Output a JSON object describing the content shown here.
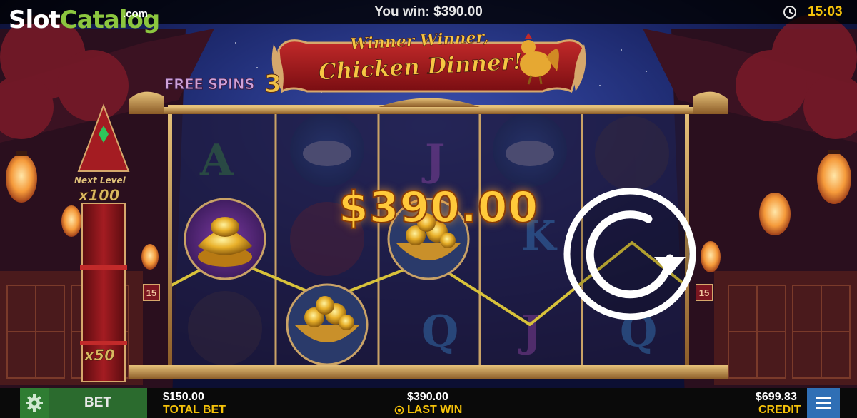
{
  "app": {
    "title": "Winner Winner, Chicken Dinner!"
  },
  "brand": {
    "logo_part1": "Slot",
    "logo_part2": "Catalog",
    "logo_suffix": ".com"
  },
  "header": {
    "win_message": "You win: $390.00",
    "time": "15:03"
  },
  "banner": {
    "line1": "Winner Winner,",
    "line2": "Chicken Dinner!"
  },
  "free_spins": {
    "label": "FREE SPINS",
    "count": "3"
  },
  "meter": {
    "next_level_label": "Next Level",
    "next_multiplier": "x100",
    "current_multiplier": "x50"
  },
  "win": {
    "amount": "$390.00"
  },
  "paylines": {
    "left_number": "15",
    "right_number": "15"
  },
  "footer": {
    "bet_label": "BET",
    "total_bet_value": "$150.00",
    "total_bet_label": "TOTAL BET",
    "last_win_value": "$390.00",
    "last_win_label": "LAST WIN",
    "credit_value": "$699.83",
    "credit_label": "CREDIT"
  },
  "icons": {
    "settings": "gear-icon",
    "menu": "hamburger-menu-icon",
    "clock": "clock-icon",
    "replay": "autoplay-replay-icon",
    "last_win_marker": "coin-icon"
  },
  "colors": {
    "accent_yellow": "#f5c20a",
    "brand_green": "#8cc63f",
    "bet_button": "#2b6b2e",
    "menu_button": "#2f6fb5",
    "win_gold": "#ffc93a"
  }
}
